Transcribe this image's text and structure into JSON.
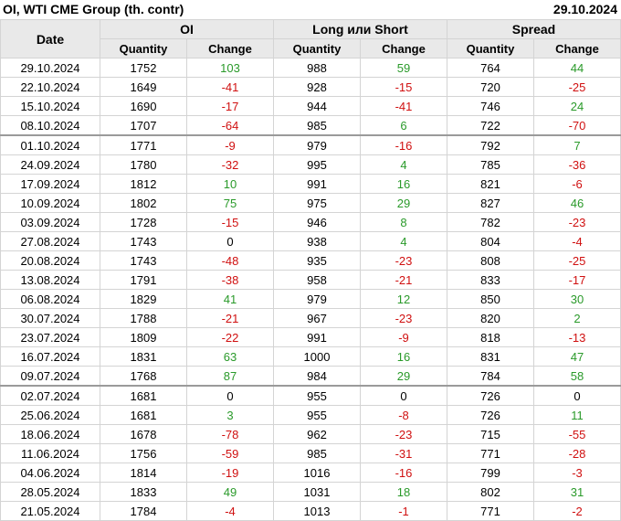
{
  "header": {
    "title": "OI, WTI CME Group (th. contr)",
    "date": "29.10.2024"
  },
  "columns": {
    "date": "Date",
    "groups": [
      "OI",
      "Long или Short",
      "Spread"
    ],
    "sub": [
      "Quantity",
      "Change",
      "Quantity",
      "Change",
      "Quantity",
      "Change"
    ]
  },
  "colors": {
    "positive": "#2a9a2a",
    "negative": "#d01010",
    "header_bg": "#e9e9e9"
  },
  "rows": [
    {
      "date": "29.10.2024",
      "oi_q": "1752",
      "oi_c": "103",
      "ls_q": "988",
      "ls_c": "59",
      "sp_q": "764",
      "sp_c": "44"
    },
    {
      "date": "22.10.2024",
      "oi_q": "1649",
      "oi_c": "-41",
      "ls_q": "928",
      "ls_c": "-15",
      "sp_q": "720",
      "sp_c": "-25"
    },
    {
      "date": "15.10.2024",
      "oi_q": "1690",
      "oi_c": "-17",
      "ls_q": "944",
      "ls_c": "-41",
      "sp_q": "746",
      "sp_c": "24"
    },
    {
      "date": "08.10.2024",
      "oi_q": "1707",
      "oi_c": "-64",
      "ls_q": "985",
      "ls_c": "6",
      "sp_q": "722",
      "sp_c": "-70"
    },
    {
      "date": "01.10.2024",
      "oi_q": "1771",
      "oi_c": "-9",
      "ls_q": "979",
      "ls_c": "-16",
      "sp_q": "792",
      "sp_c": "7",
      "sep": true
    },
    {
      "date": "24.09.2024",
      "oi_q": "1780",
      "oi_c": "-32",
      "ls_q": "995",
      "ls_c": "4",
      "sp_q": "785",
      "sp_c": "-36"
    },
    {
      "date": "17.09.2024",
      "oi_q": "1812",
      "oi_c": "10",
      "ls_q": "991",
      "ls_c": "16",
      "sp_q": "821",
      "sp_c": "-6"
    },
    {
      "date": "10.09.2024",
      "oi_q": "1802",
      "oi_c": "75",
      "ls_q": "975",
      "ls_c": "29",
      "sp_q": "827",
      "sp_c": "46"
    },
    {
      "date": "03.09.2024",
      "oi_q": "1728",
      "oi_c": "-15",
      "ls_q": "946",
      "ls_c": "8",
      "sp_q": "782",
      "sp_c": "-23"
    },
    {
      "date": "27.08.2024",
      "oi_q": "1743",
      "oi_c": "0",
      "ls_q": "938",
      "ls_c": "4",
      "sp_q": "804",
      "sp_c": "-4"
    },
    {
      "date": "20.08.2024",
      "oi_q": "1743",
      "oi_c": "-48",
      "ls_q": "935",
      "ls_c": "-23",
      "sp_q": "808",
      "sp_c": "-25"
    },
    {
      "date": "13.08.2024",
      "oi_q": "1791",
      "oi_c": "-38",
      "ls_q": "958",
      "ls_c": "-21",
      "sp_q": "833",
      "sp_c": "-17"
    },
    {
      "date": "06.08.2024",
      "oi_q": "1829",
      "oi_c": "41",
      "ls_q": "979",
      "ls_c": "12",
      "sp_q": "850",
      "sp_c": "30"
    },
    {
      "date": "30.07.2024",
      "oi_q": "1788",
      "oi_c": "-21",
      "ls_q": "967",
      "ls_c": "-23",
      "sp_q": "820",
      "sp_c": "2"
    },
    {
      "date": "23.07.2024",
      "oi_q": "1809",
      "oi_c": "-22",
      "ls_q": "991",
      "ls_c": "-9",
      "sp_q": "818",
      "sp_c": "-13"
    },
    {
      "date": "16.07.2024",
      "oi_q": "1831",
      "oi_c": "63",
      "ls_q": "1000",
      "ls_c": "16",
      "sp_q": "831",
      "sp_c": "47"
    },
    {
      "date": "09.07.2024",
      "oi_q": "1768",
      "oi_c": "87",
      "ls_q": "984",
      "ls_c": "29",
      "sp_q": "784",
      "sp_c": "58"
    },
    {
      "date": "02.07.2024",
      "oi_q": "1681",
      "oi_c": "0",
      "ls_q": "955",
      "ls_c": "0",
      "sp_q": "726",
      "sp_c": "0",
      "sep": true
    },
    {
      "date": "25.06.2024",
      "oi_q": "1681",
      "oi_c": "3",
      "ls_q": "955",
      "ls_c": "-8",
      "sp_q": "726",
      "sp_c": "11"
    },
    {
      "date": "18.06.2024",
      "oi_q": "1678",
      "oi_c": "-78",
      "ls_q": "962",
      "ls_c": "-23",
      "sp_q": "715",
      "sp_c": "-55"
    },
    {
      "date": "11.06.2024",
      "oi_q": "1756",
      "oi_c": "-59",
      "ls_q": "985",
      "ls_c": "-31",
      "sp_q": "771",
      "sp_c": "-28"
    },
    {
      "date": "04.06.2024",
      "oi_q": "1814",
      "oi_c": "-19",
      "ls_q": "1016",
      "ls_c": "-16",
      "sp_q": "799",
      "sp_c": "-3"
    },
    {
      "date": "28.05.2024",
      "oi_q": "1833",
      "oi_c": "49",
      "ls_q": "1031",
      "ls_c": "18",
      "sp_q": "802",
      "sp_c": "31"
    },
    {
      "date": "21.05.2024",
      "oi_q": "1784",
      "oi_c": "-4",
      "ls_q": "1013",
      "ls_c": "-1",
      "sp_q": "771",
      "sp_c": "-2"
    }
  ]
}
